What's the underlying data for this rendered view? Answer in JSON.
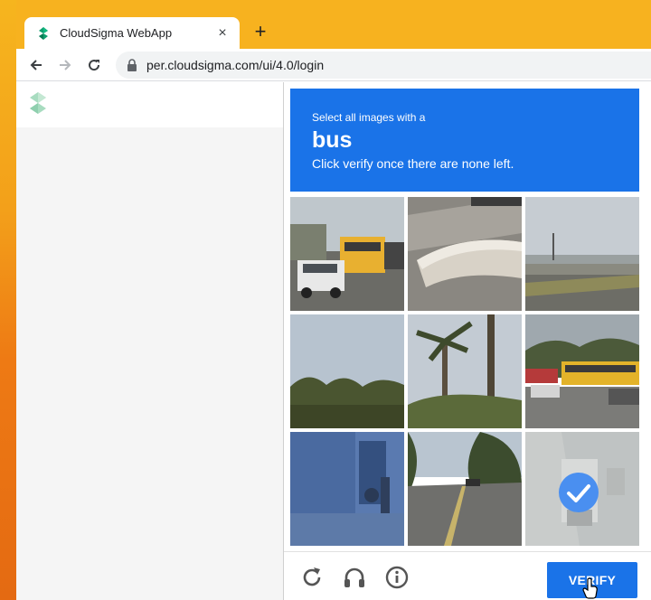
{
  "browser": {
    "tab_title": "CloudSigma WebApp",
    "new_tab_label": "+",
    "close_label": "×",
    "url": "per.cloudsigma.com/ui/4.0/login"
  },
  "captcha": {
    "instruction_small": "Select all images with a",
    "target_object": "bus",
    "instruction_sub": "Click verify once there are none left.",
    "verify_label": "VERIFY",
    "header_color": "#1a73e8",
    "tiles": [
      {
        "index": 1,
        "selected": false
      },
      {
        "index": 2,
        "selected": false
      },
      {
        "index": 3,
        "selected": false
      },
      {
        "index": 4,
        "selected": false
      },
      {
        "index": 5,
        "selected": false
      },
      {
        "index": 6,
        "selected": false
      },
      {
        "index": 7,
        "selected": false
      },
      {
        "index": 8,
        "selected": false
      },
      {
        "index": 9,
        "selected": true
      }
    ],
    "footer_icons": [
      "reload-icon",
      "audio-challenge-icon",
      "info-icon"
    ]
  }
}
